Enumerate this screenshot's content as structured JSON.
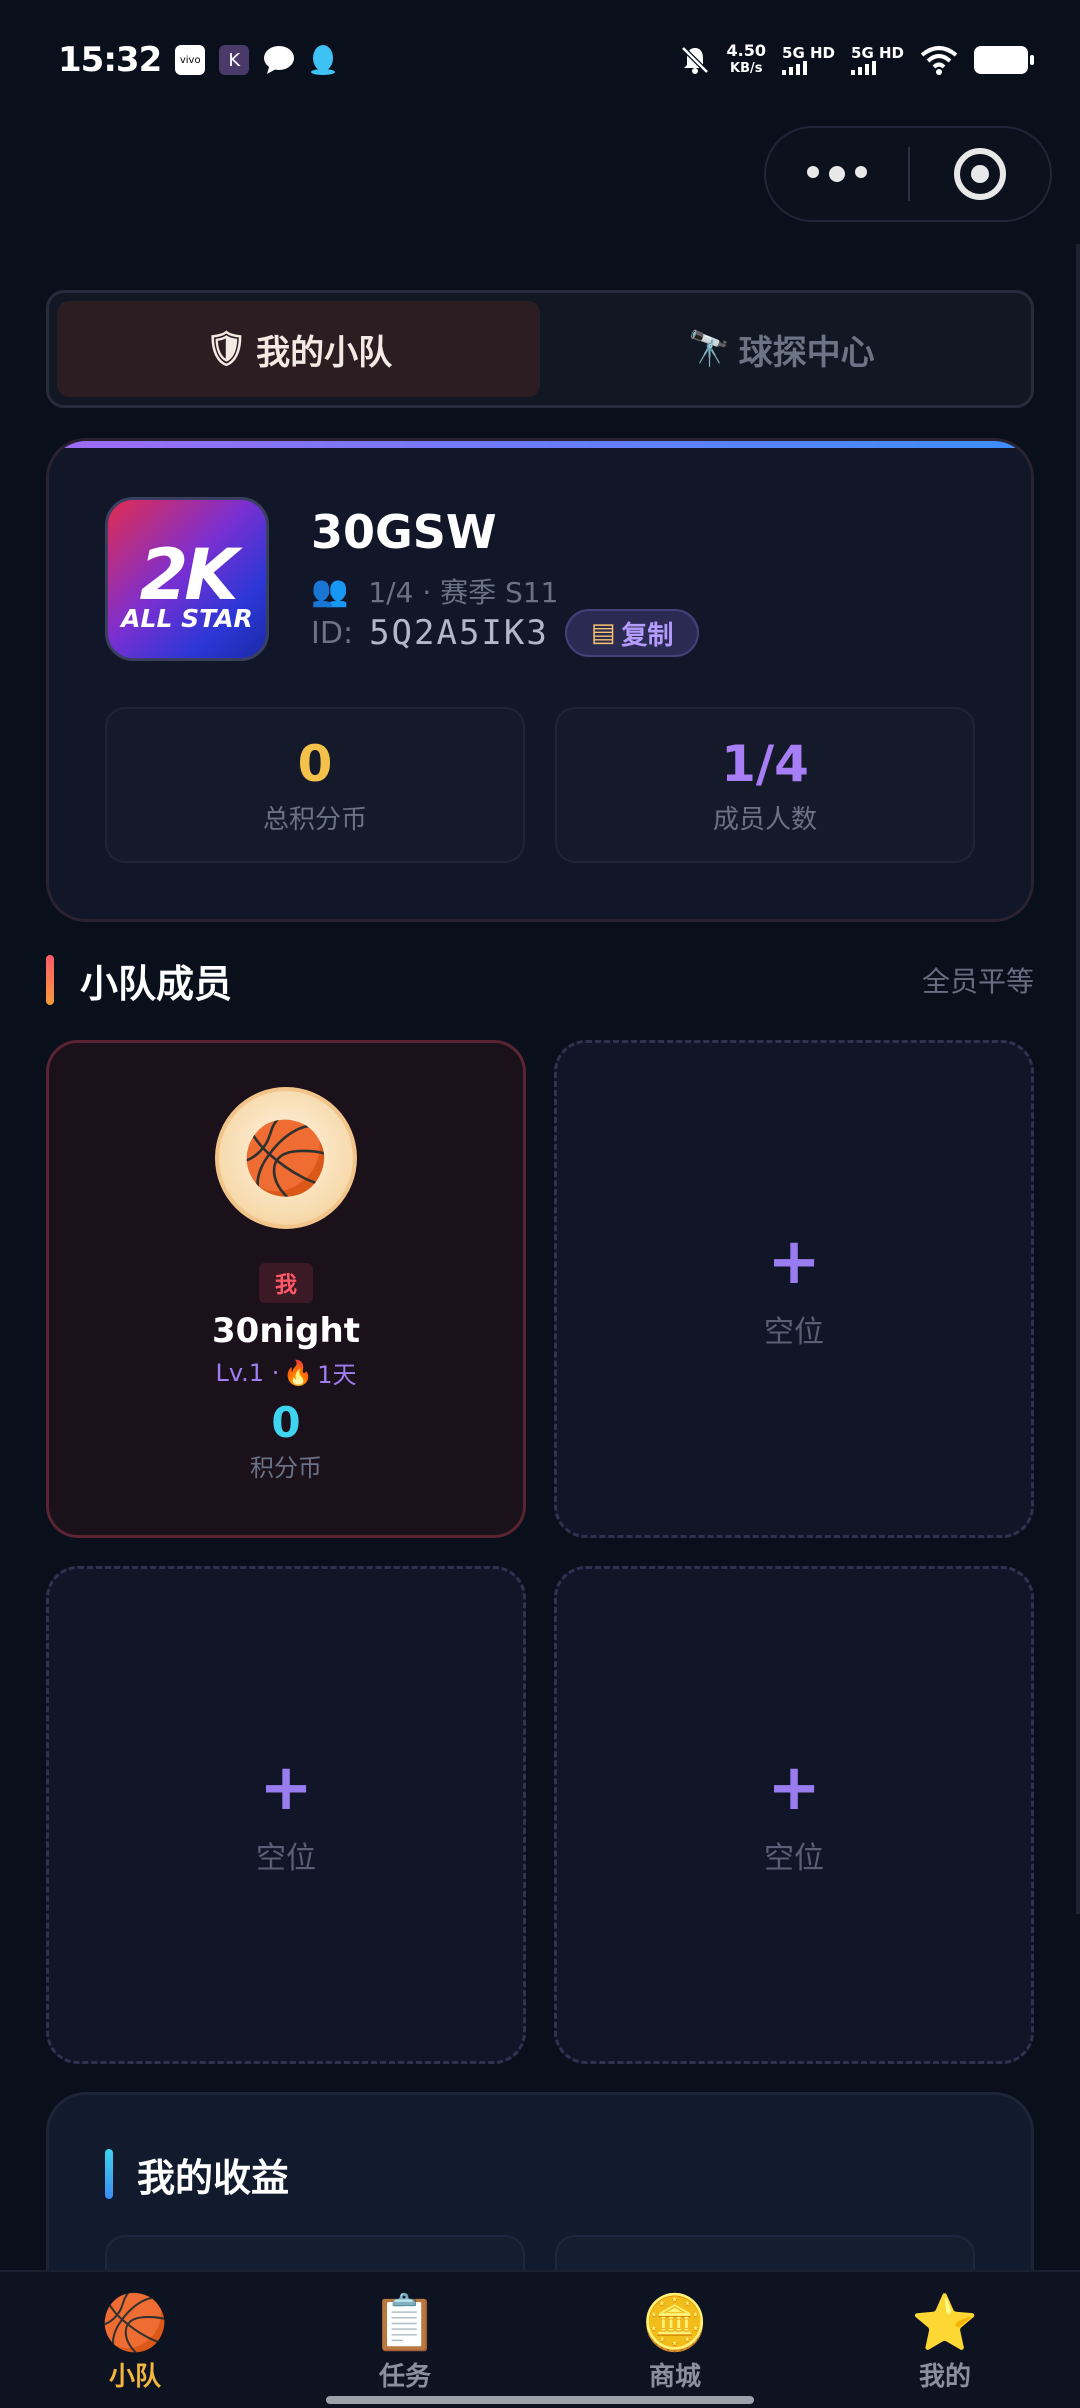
{
  "status_bar": {
    "time": "15:32",
    "apps": [
      "vivo",
      "K",
      "chat-icon",
      "qq-icon"
    ],
    "net_speed": "4.50",
    "net_unit": "KB/s",
    "sim1": "5G HD",
    "sim2": "5G HD"
  },
  "tabs": [
    {
      "label": "我的小队",
      "icon": "shield-star-icon",
      "active": true
    },
    {
      "label": "球探中心",
      "icon": "telescope-icon",
      "active": false
    }
  ],
  "team": {
    "logo_line1": "2K",
    "logo_line2": "ALL STAR",
    "name": "30GSW",
    "members_season": "1/4 · 赛季 S11",
    "id_label": "ID:",
    "id_value": "5Q2A5IK3",
    "copy_label": "复制",
    "stats": [
      {
        "value": "0",
        "label": "总积分币"
      },
      {
        "value": "1/4",
        "label": "成员人数"
      }
    ]
  },
  "members_section": {
    "title": "小队成员",
    "right_text": "全员平等"
  },
  "me": {
    "badge": "我",
    "name": "30night",
    "level": "Lv.1 ·",
    "streak": "1天",
    "score": "0",
    "score_label": "积分币"
  },
  "empty_slot": {
    "plus": "+",
    "label": "空位"
  },
  "earnings": {
    "title": "我的收益"
  },
  "bottom_nav": [
    {
      "label": "小队",
      "icon": "team-icon",
      "active": true
    },
    {
      "label": "任务",
      "icon": "task-icon",
      "active": false
    },
    {
      "label": "商城",
      "icon": "shop-icon",
      "active": false
    },
    {
      "label": "我的",
      "icon": "profile-icon",
      "active": false
    }
  ],
  "colors": {
    "background": "#0a0f1c",
    "accent_gold": "#f4c14b",
    "accent_purple": "#a77ef5",
    "accent_cyan": "#3fd4f0",
    "accent_red": "#ff5868"
  }
}
